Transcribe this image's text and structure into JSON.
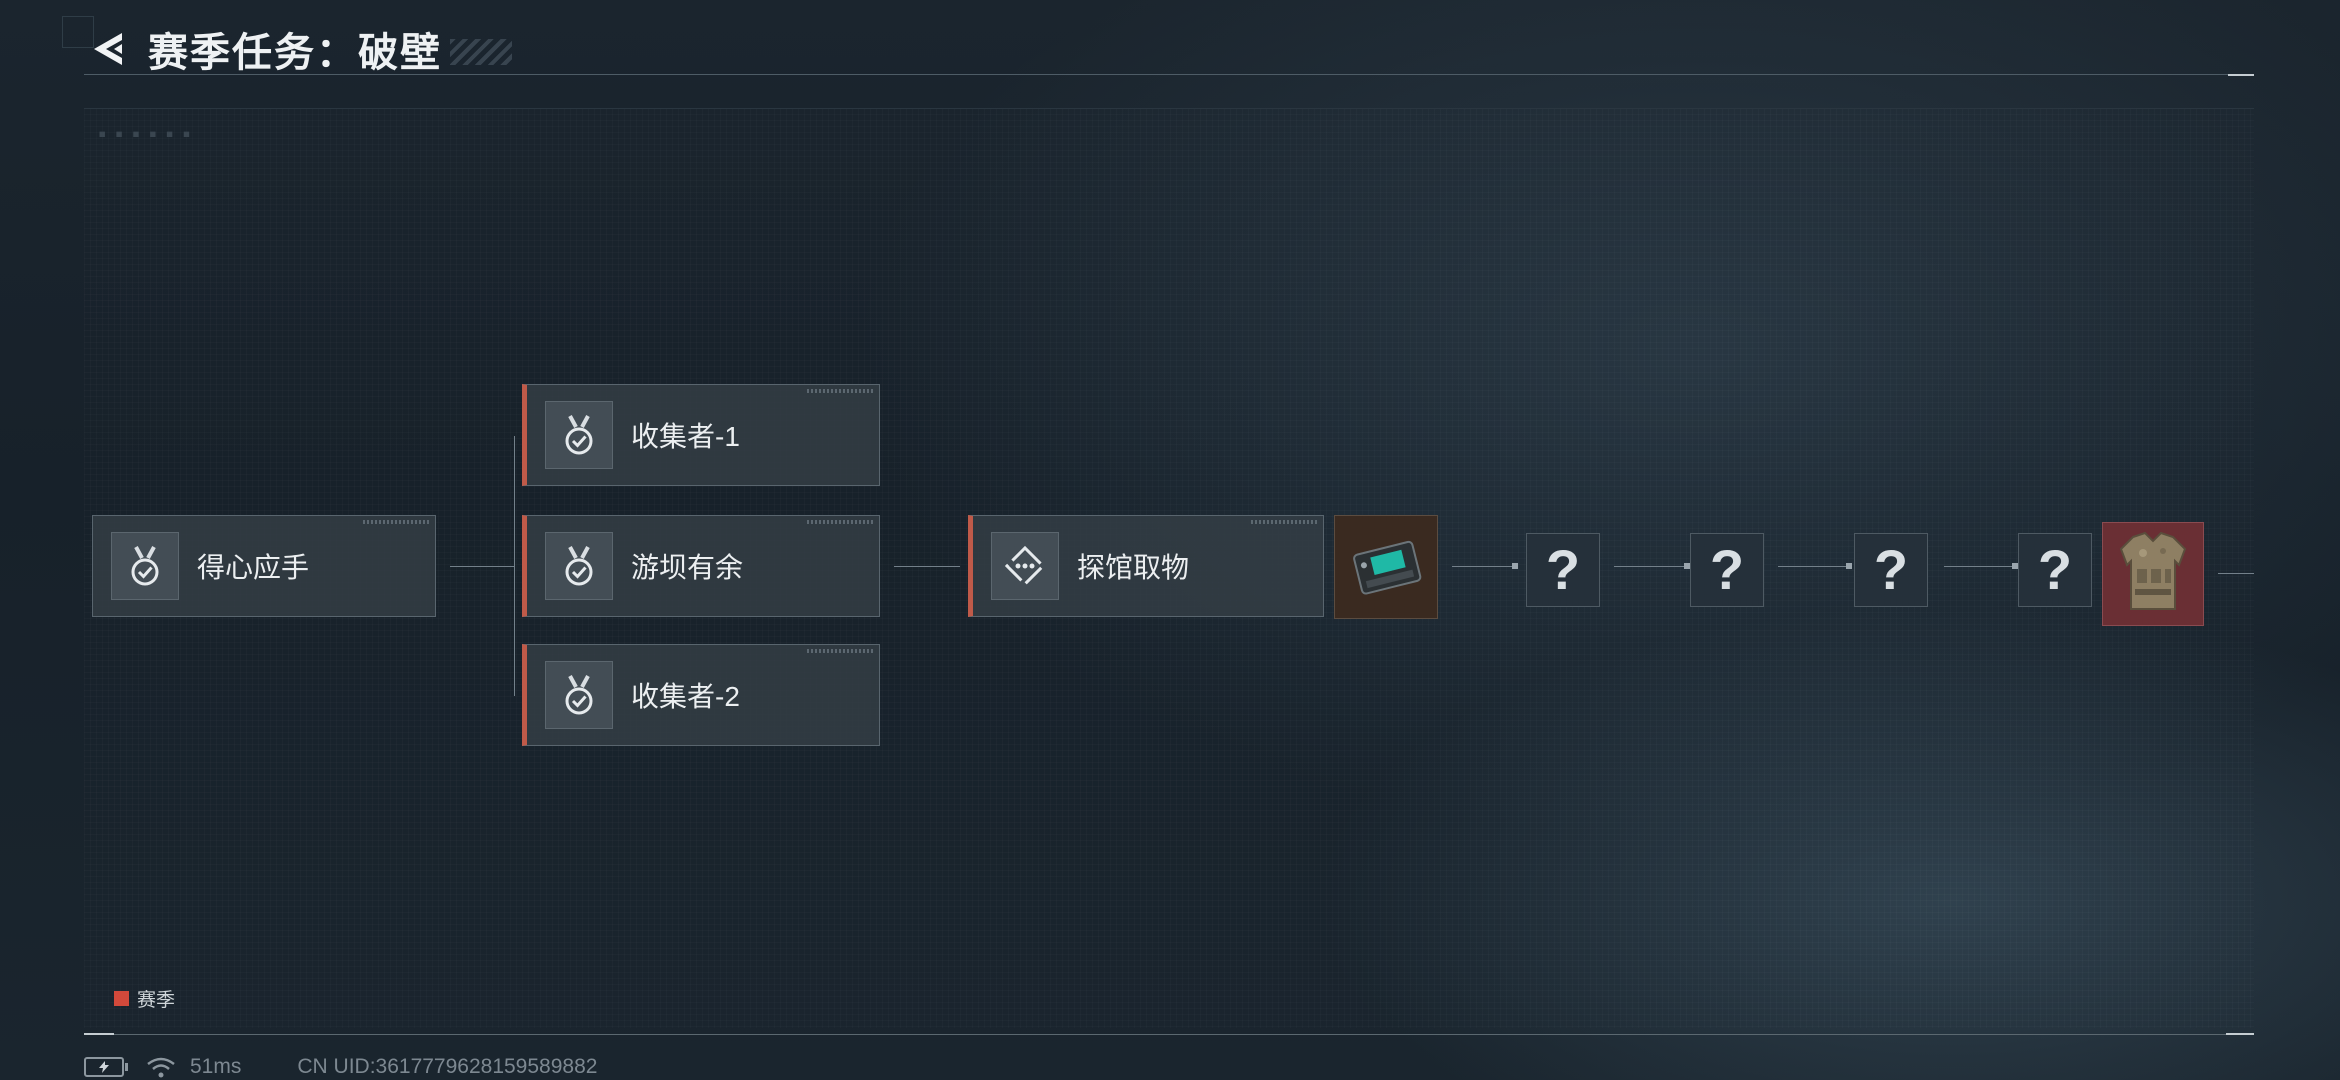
{
  "header": {
    "title": "赛季任务：破壁"
  },
  "missions": {
    "start": {
      "label": "得心应手",
      "icon": "medal-check-icon"
    },
    "branch": [
      {
        "label": "收集者-1",
        "icon": "medal-check-icon"
      },
      {
        "label": "游坝有余",
        "icon": "medal-check-icon"
      },
      {
        "label": "收集者-2",
        "icon": "medal-check-icon"
      }
    ],
    "current": {
      "label": "探馆取物",
      "icon": "diamond-route-icon"
    }
  },
  "rewards": {
    "device": {
      "icon": "gadget-device-icon"
    },
    "mystery": [
      "?",
      "?",
      "?",
      "?"
    ],
    "final": {
      "icon": "body-armor-icon"
    }
  },
  "legend": {
    "label": "赛季",
    "color": "#d2493b"
  },
  "status": {
    "ping": "51ms",
    "uid": "CN UID:3617779628159589882"
  },
  "colors": {
    "accent": "#c05a49",
    "background": "#1b252e",
    "card": "#343e46"
  }
}
